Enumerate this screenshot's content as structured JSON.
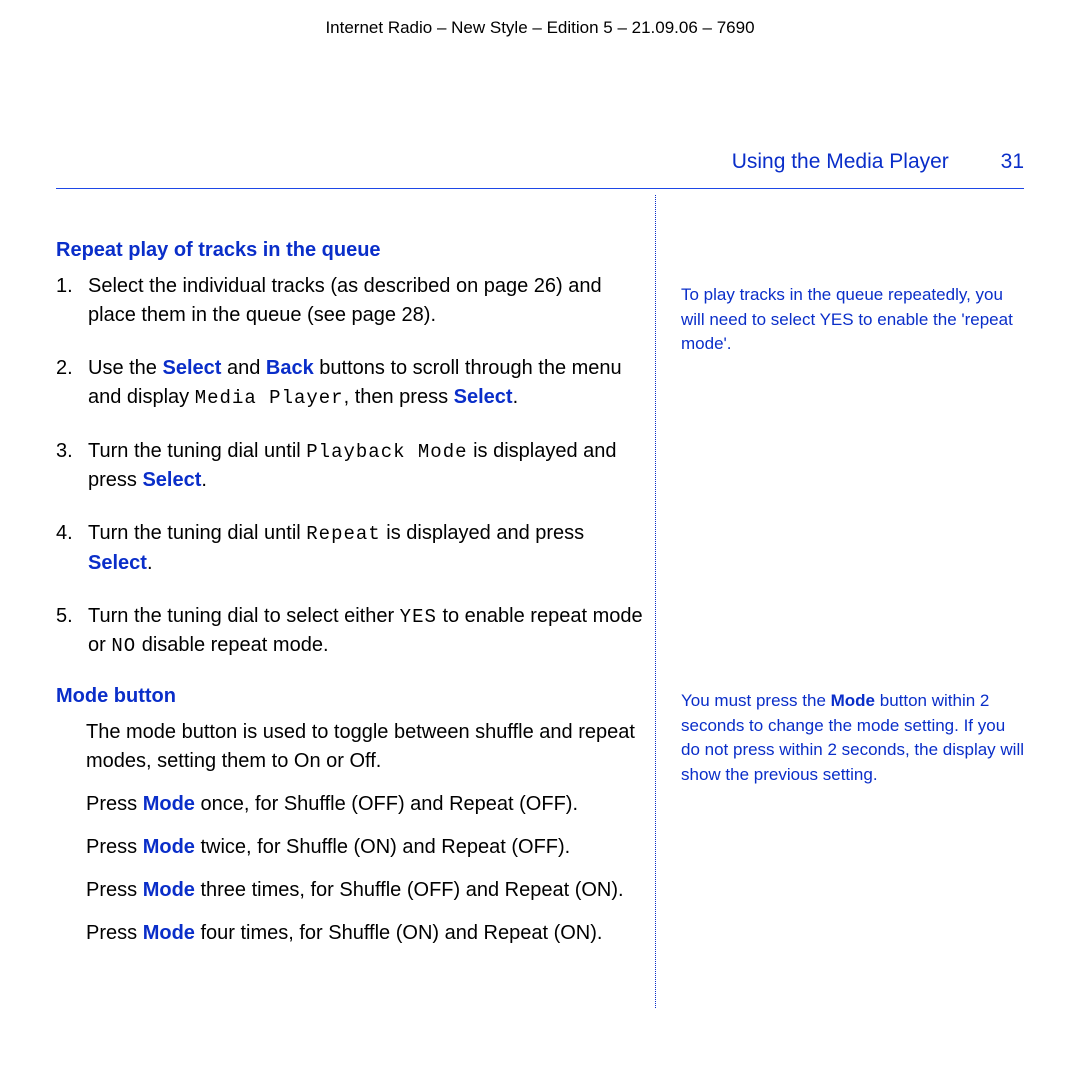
{
  "header": "Internet Radio – New Style – Edition 5 – 21.09.06 – 7690",
  "running_head": {
    "title": "Using the Media Player",
    "page_no": "31"
  },
  "main": {
    "section1_title": "Repeat play of tracks in the queue",
    "step1": "Select the individual tracks (as described on page 26) and place them in the queue (see page 28).",
    "step2_a": "Use the ",
    "step2_select": "Select",
    "step2_b": " and ",
    "step2_back": "Back",
    "step2_c": " buttons to scroll through the menu and display ",
    "step2_lcd": "Media Player",
    "step2_d": ", then press ",
    "step2_select2": "Select",
    "step2_e": ".",
    "step3_a": "Turn the tuning dial until ",
    "step3_lcd": "Playback Mode",
    "step3_b": " is displayed and press ",
    "step3_select": "Select",
    "step3_c": ".",
    "step4_a": "Turn the tuning dial until ",
    "step4_lcd": "Repeat",
    "step4_b": " is displayed and press ",
    "step4_select": "Select",
    "step4_c": ".",
    "step5_a": "Turn the tuning dial to select either ",
    "step5_yes": "YES",
    "step5_b": " to enable repeat mode or ",
    "step5_no": "NO",
    "step5_c": " disable repeat mode.",
    "section2_title": "Mode button",
    "mode_intro": "The mode button is used to toggle between shuffle and repeat modes, setting them to On or Off.",
    "mode_pfx": "Press ",
    "mode_word": "Mode",
    "mode1_tail": " once, for Shuffle (OFF) and Repeat (OFF).",
    "mode2_tail": " twice, for Shuffle (ON) and Repeat (OFF).",
    "mode3_tail": " three times, for Shuffle (OFF) and Repeat (ON).",
    "mode4_tail": " four times, for Shuffle (ON) and Repeat (ON)."
  },
  "side": {
    "note1": "To play tracks in the queue repeatedly, you will need to select YES to enable the 'repeat mode'.",
    "note2_a": "You must press the ",
    "note2_mode": "Mode",
    "note2_b": " button within 2 seconds to change the mode setting. If you do not press within 2 seconds, the display will show the previous setting."
  }
}
